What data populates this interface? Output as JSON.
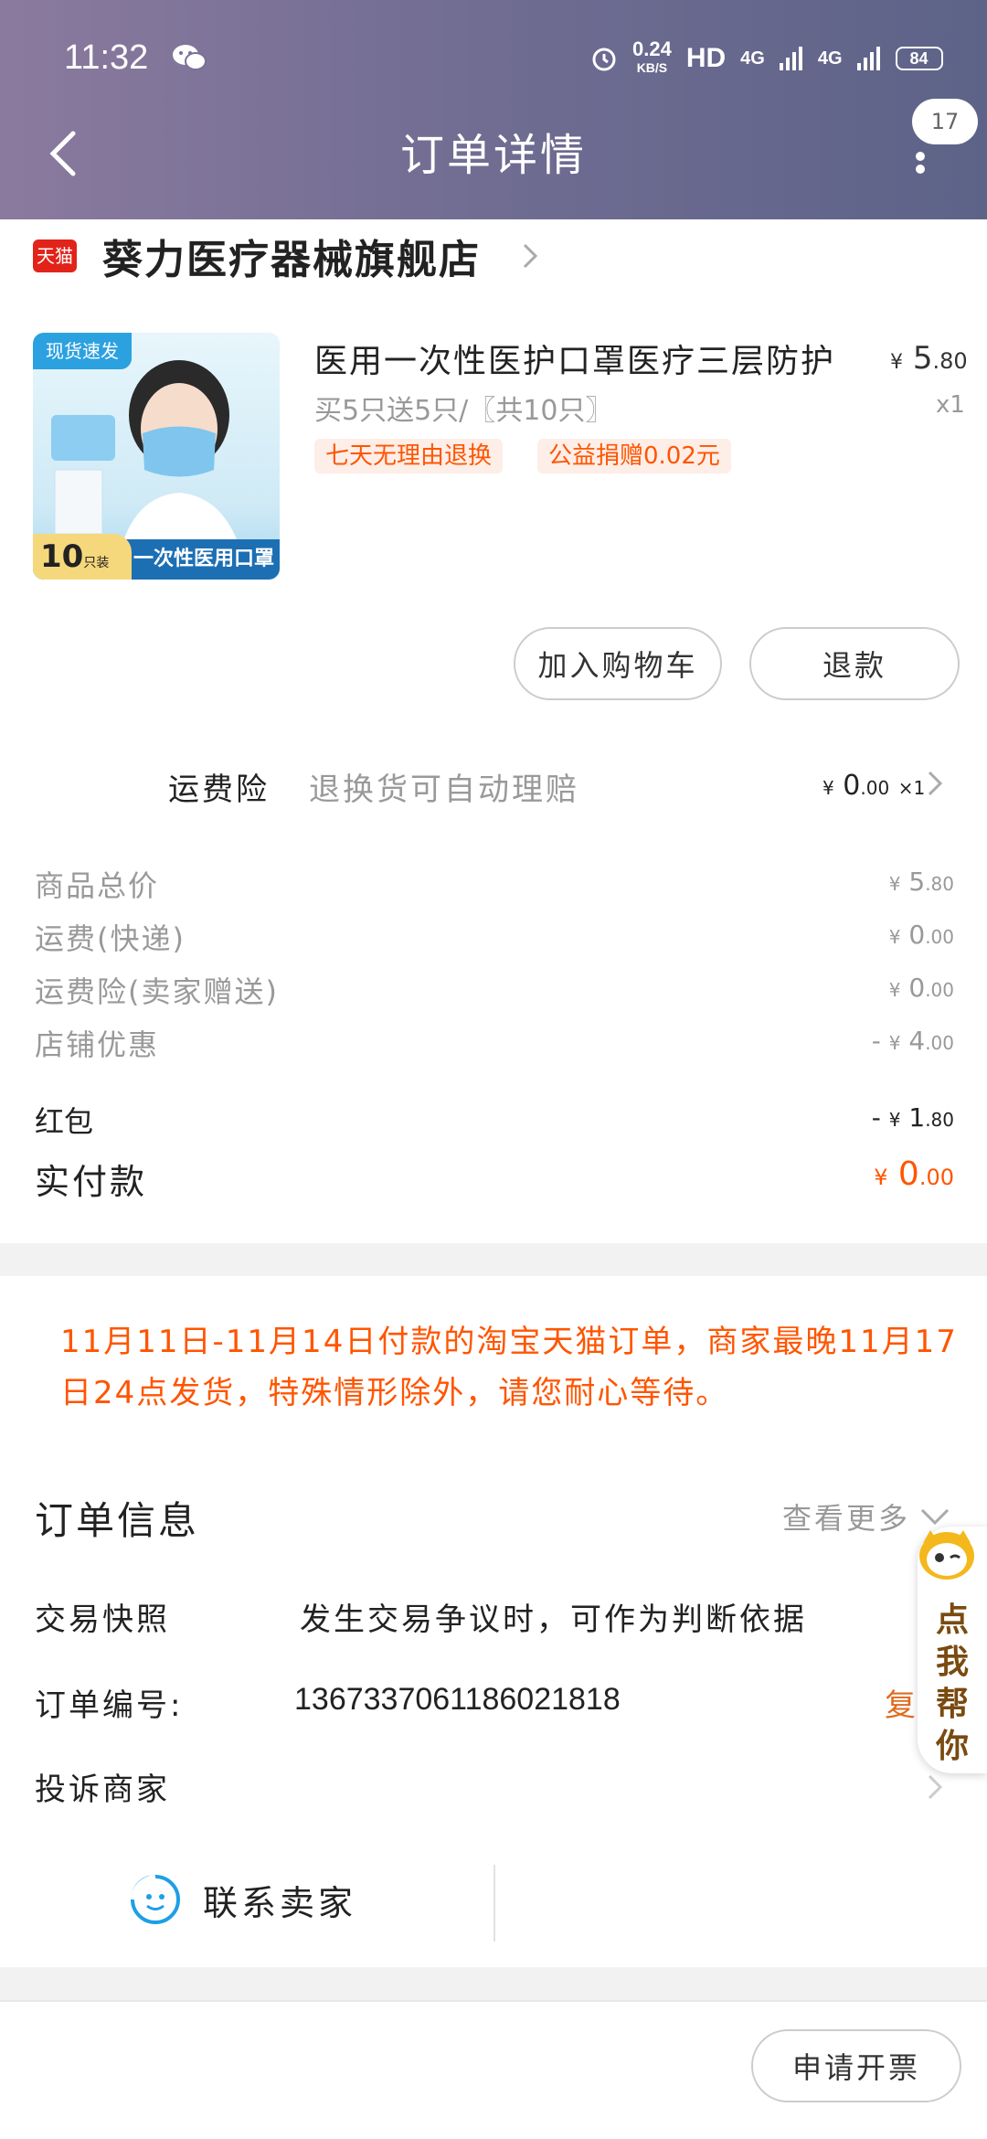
{
  "status_bar": {
    "time": "11:32",
    "speed_value": "0.24",
    "speed_unit": "KB/S",
    "hd": "HD",
    "net1": "4G",
    "net2": "4G",
    "battery": "84",
    "icons": [
      "wechat-icon",
      "alarm-icon",
      "signal-icon",
      "battery-icon"
    ]
  },
  "header": {
    "title": "订单详情",
    "badge": "17"
  },
  "shop": {
    "badge": "天猫",
    "name": "葵力医疗器械旗舰店"
  },
  "product": {
    "image_tag": "现货速发",
    "image_count": "10",
    "image_count_unit": "只装",
    "image_caption": "一次性医用口罩",
    "title": "医用一次性医护口罩医疗三层防护",
    "price_currency": "¥",
    "price_int": "5",
    "price_dec": ".80",
    "spec": "买5只送5只/〖共10只〗",
    "qty": "x1",
    "tags": [
      "七天无理由退换",
      "公益捐赠0.02元"
    ]
  },
  "actions": {
    "cart": "加入购物车",
    "refund": "退款"
  },
  "insurance": {
    "label": "运费险",
    "desc": "退换货可自动理赔",
    "currency": "¥",
    "int": "0",
    "dec": ".00",
    "mult": "×1"
  },
  "fees": [
    {
      "label": "商品总价",
      "prefix": "",
      "currency": "¥",
      "int": "5",
      "dec": ".80"
    },
    {
      "label": "运费(快递)",
      "prefix": "",
      "currency": "¥",
      "int": "0",
      "dec": ".00"
    },
    {
      "label": "运费险(卖家赠送)",
      "prefix": "",
      "currency": "¥",
      "int": "0",
      "dec": ".00"
    },
    {
      "label": "店铺优惠",
      "prefix": "- ",
      "currency": "¥",
      "int": "4",
      "dec": ".00"
    }
  ],
  "red_packet": {
    "label": "红包",
    "prefix": "- ",
    "currency": "¥",
    "int": "1",
    "dec": ".80"
  },
  "paid": {
    "label": "实付款",
    "currency": "¥",
    "int": "0",
    "dec": ".00"
  },
  "notice": "11月11日-11月14日付款的淘宝天猫订单，商家最晚11月17日24点发货，特殊情形除外，请您耐心等待。",
  "order_info": {
    "title": "订单信息",
    "see_more": "查看更多",
    "snapshot_label": "交易快照",
    "snapshot_value": "发生交易争议时，可作为判断依据",
    "order_no_label": "订单编号:",
    "order_no": "1367337061186021818",
    "copy": "复",
    "complain_label": "投诉商家"
  },
  "contact": {
    "label": "联系卖家"
  },
  "helper": {
    "text": "点我帮你"
  },
  "invoice": {
    "label": "申请开票"
  },
  "colors": {
    "accent": "#ff5500",
    "header_start": "#8a7a9e",
    "header_end": "#5d6388",
    "tmall_red": "#e2231a"
  }
}
